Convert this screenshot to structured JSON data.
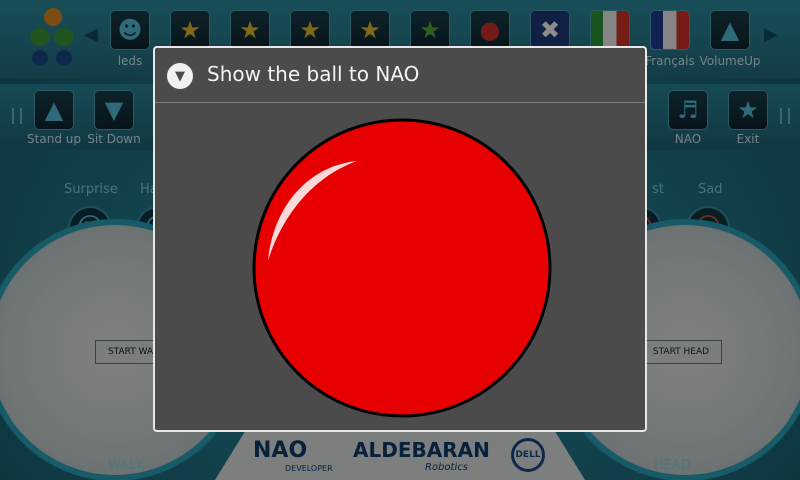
{
  "top_bar": {
    "items": [
      {
        "label": "",
        "icon": "nao-robot-logo"
      },
      {
        "label": "leds",
        "icon": "leds-icon"
      },
      {
        "label": "",
        "icon": "star-icon"
      },
      {
        "label": "",
        "icon": "star-icon"
      },
      {
        "label": "",
        "icon": "star-icon"
      },
      {
        "label": "",
        "icon": "star-icon"
      },
      {
        "label": "",
        "icon": "star-icon"
      },
      {
        "label": "",
        "icon": "record-icon"
      },
      {
        "label": "",
        "icon": "uk-flag-icon"
      },
      {
        "label": "",
        "icon": "italian-flag-icon"
      },
      {
        "label": "Français",
        "icon": "french-flag-icon"
      },
      {
        "label": "VolumeUp",
        "icon": "volume-up-icon"
      }
    ]
  },
  "second_bar": {
    "left": [
      {
        "label": "Stand up",
        "icon": "triangle-up-icon"
      },
      {
        "label": "Sit Down",
        "icon": "triangle-down-icon"
      }
    ],
    "right": [
      {
        "label": "NAO",
        "icon": "nao-icon"
      },
      {
        "label": "Exit",
        "icon": "star-exit-icon"
      }
    ]
  },
  "emotions": {
    "surprise": "Surprise",
    "happy_partial": "Ha",
    "sad": "Sad",
    "other_partial": "st"
  },
  "walk": {
    "button": "START WALK",
    "label": "WALK"
  },
  "head": {
    "button": "START HEAD",
    "label": "HEAD"
  },
  "footer": {
    "nao_logo": "NAO",
    "nao_sub": "DEVELOPER",
    "aldebaran": "ALDEBARAN",
    "aldebaran_sub": "Robotics",
    "dell": "DELL"
  },
  "dialog": {
    "title": "Show the ball to NAO",
    "ball_color": "#e60000"
  }
}
